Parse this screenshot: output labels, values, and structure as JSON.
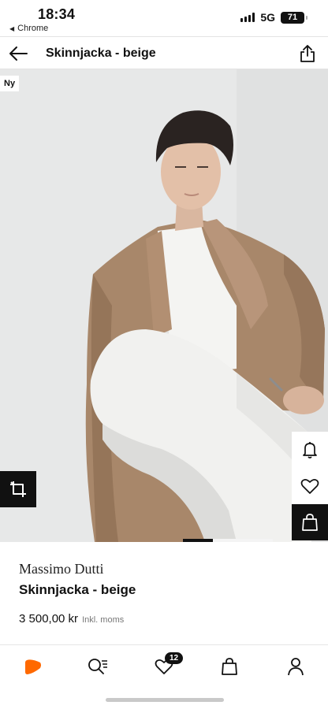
{
  "status_bar": {
    "time": "18:34",
    "back_app": "Chrome",
    "network": "5G",
    "battery": "71"
  },
  "header": {
    "title": "Skinnjacka - beige",
    "icons": {
      "back": "arrow-left-icon",
      "share": "share-icon"
    }
  },
  "image": {
    "badge": "Ny",
    "gallery": {
      "count": 3,
      "active": 1
    },
    "actions": [
      "crop-icon",
      "bell-icon",
      "heart-icon",
      "shopping-bag-icon"
    ]
  },
  "product": {
    "brand": "Massimo Dutti",
    "name": "Skinnjacka - beige",
    "price": "3 500,00 kr",
    "vat_note": "Inkl. moms"
  },
  "bottom_nav": {
    "items": [
      "home-icon",
      "search-icon",
      "wishlist-icon",
      "bag-icon",
      "profile-icon"
    ],
    "wishlist_count": "12"
  },
  "colors": {
    "accent": "#ff6900",
    "jacket": "#a8876a",
    "background": "#e8e9e9"
  }
}
